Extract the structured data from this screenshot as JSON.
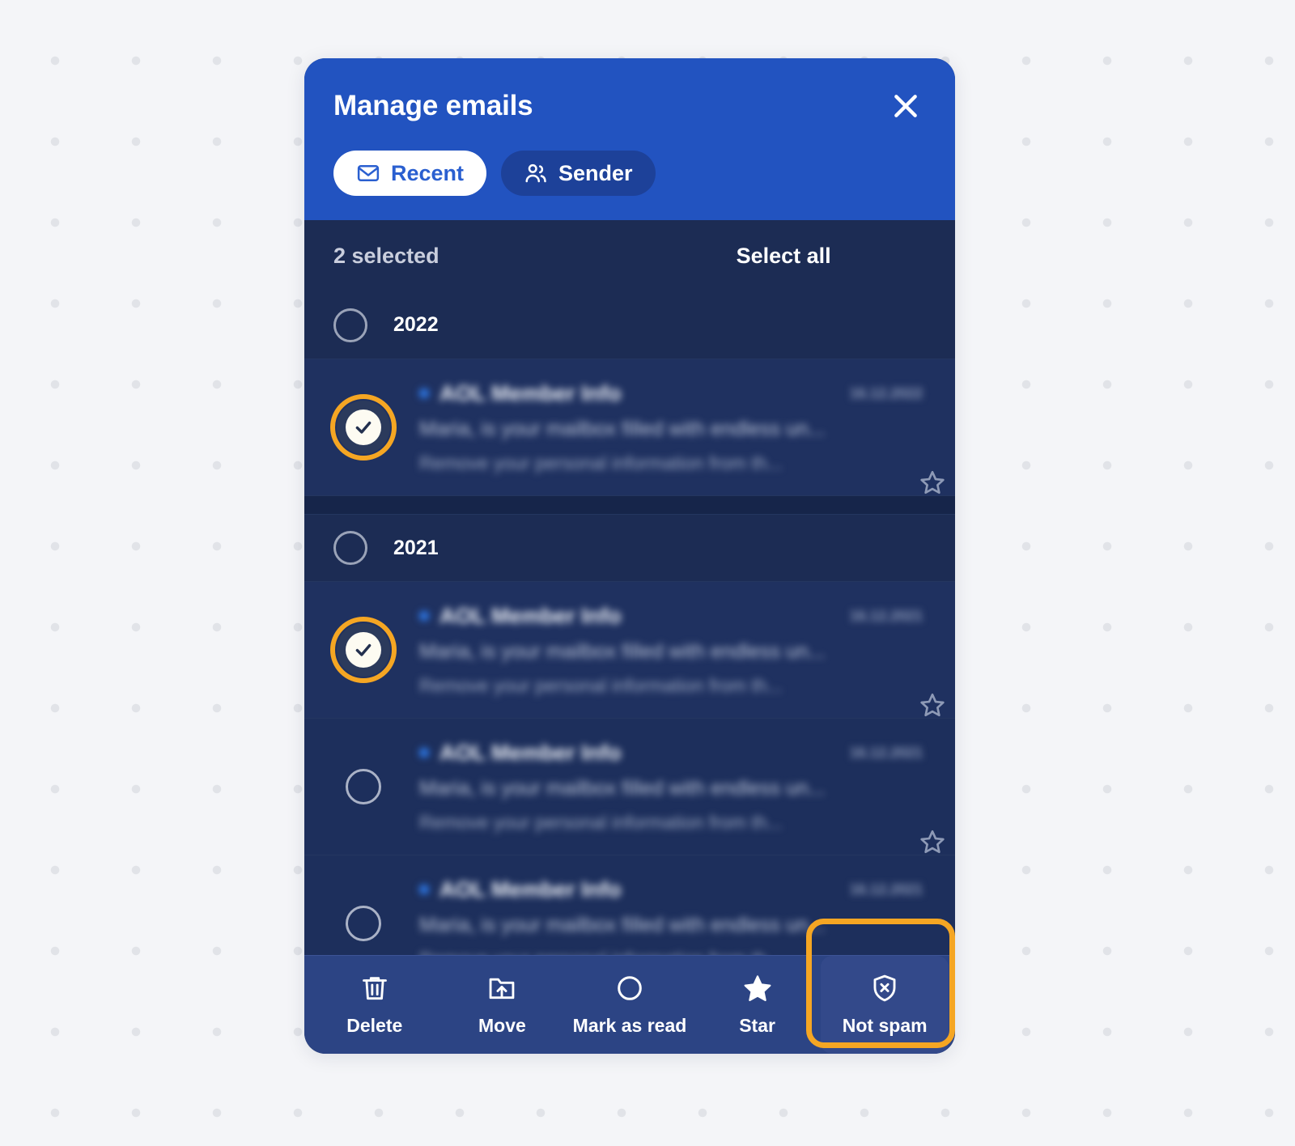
{
  "header": {
    "title": "Manage emails",
    "close_icon": "close-icon",
    "tabs": [
      {
        "label": "Recent",
        "icon": "envelope-icon",
        "active": true
      },
      {
        "label": "Sender",
        "icon": "people-icon",
        "active": false
      }
    ]
  },
  "selection": {
    "count_label": "2 selected",
    "select_all_label": "Select all"
  },
  "list": [
    {
      "type": "year",
      "label": "2022",
      "checked": false
    },
    {
      "type": "email",
      "subject": "AOL Member Info",
      "preview": "Maria, is your mailbox filled with endless un...",
      "preview2": "Remove your personal information from th...",
      "date": "16.12.2022",
      "checked": true,
      "highlighted": true,
      "unread": true,
      "starred": false
    },
    {
      "type": "year",
      "label": "2021",
      "checked": false
    },
    {
      "type": "email",
      "subject": "AOL Member Info",
      "preview": "Maria, is your mailbox filled with endless un...",
      "preview2": "Remove your personal information from th...",
      "date": "16.12.2021",
      "checked": true,
      "highlighted": true,
      "unread": true,
      "starred": false
    },
    {
      "type": "email",
      "subject": "AOL Member Info",
      "preview": "Maria, is your mailbox filled with endless un...",
      "preview2": "Remove your personal information from th...",
      "date": "16.12.2021",
      "checked": false,
      "highlighted": false,
      "unread": true,
      "starred": false
    },
    {
      "type": "email",
      "subject": "AOL Member Info",
      "preview": "Maria, is your mailbox filled with endless un...",
      "preview2": "Remove your personal information from th...",
      "date": "16.12.2021",
      "checked": false,
      "highlighted": false,
      "unread": true,
      "starred": false
    }
  ],
  "toolbar": [
    {
      "label": "Delete",
      "icon": "trash-icon",
      "highlighted": false
    },
    {
      "label": "Move",
      "icon": "folder-move-icon",
      "highlighted": false
    },
    {
      "label": "Mark as read",
      "icon": "circle-icon",
      "highlighted": false
    },
    {
      "label": "Star",
      "icon": "star-filled-icon",
      "highlighted": false
    },
    {
      "label": "Not spam",
      "icon": "shield-x-icon",
      "highlighted": true
    }
  ],
  "colors": {
    "page_background": "#f4f5f8",
    "dot": "#e1e3e8",
    "header_blue": "#2253c0",
    "modal_body": "#1c2c54",
    "row_selected": "#1f3160",
    "row_normal": "#1d2f5c",
    "toolbar": "#2c4484",
    "accent_highlight": "#f5a623",
    "tab_active_text": "#2a5fd0",
    "unread_dot": "#2e7df0"
  }
}
